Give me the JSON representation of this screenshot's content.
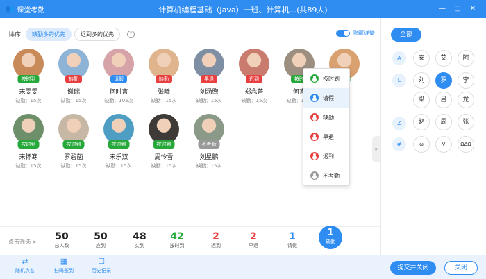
{
  "titlebar": {
    "app_name": "课堂考勤",
    "title": "计算机编程基础（Java）一班、计算机...(共89人)"
  },
  "sort": {
    "label": "排序:",
    "option1": "缺勤多的优先",
    "option2": "迟到多的优先",
    "help": "?"
  },
  "toggle_label": "隐藏详情",
  "status_colors": {
    "按时到": "#26a83a",
    "缺勤": "#e84040",
    "请假": "#2f8cf1",
    "早退": "#e84040",
    "迟到": "#e84040",
    "不考勤": "#999999"
  },
  "students": [
    {
      "name": "宋雯雯",
      "absent": "缺勤：15次",
      "status": "按时到"
    },
    {
      "name": "谢瑞",
      "absent": "缺勤：15次",
      "status": "缺勤"
    },
    {
      "name": "何时言",
      "absent": "缺勤：105次",
      "status": "请假"
    },
    {
      "name": "张曦",
      "absent": "缺勤：15次",
      "status": "缺勤"
    },
    {
      "name": "刘涵煦",
      "absent": "缺勤：15次",
      "status": "早退"
    },
    {
      "name": "郑念普",
      "absent": "缺勤：15次",
      "status": "迟到"
    },
    {
      "name": "何言",
      "absent": "缺勤：15次",
      "status": "按时"
    },
    {
      "name": "昕",
      "absent": "12次",
      "status": "到"
    },
    {
      "name": "宋怀寒",
      "absent": "缺勤：15次",
      "status": "按时到"
    },
    {
      "name": "罗碧菡",
      "absent": "缺勤：15次",
      "status": "按时到"
    },
    {
      "name": "宋乐双",
      "absent": "缺勤：15次",
      "status": "按时到"
    },
    {
      "name": "周怜雪",
      "absent": "缺勤：15次",
      "status": "按时到"
    },
    {
      "name": "刘星鹏",
      "absent": "缺勤：15次",
      "status": "不考勤"
    }
  ],
  "menu": [
    {
      "label": "按时到",
      "color": "#26a83a"
    },
    {
      "label": "请假",
      "color": "#2f8cf1"
    },
    {
      "label": "缺勤",
      "color": "#e84040"
    },
    {
      "label": "早退",
      "color": "#e84040"
    },
    {
      "label": "迟到",
      "color": "#e84040"
    },
    {
      "label": "不考勤",
      "color": "#999999"
    }
  ],
  "right": {
    "all": "全部",
    "letters": [
      "A",
      "L",
      "Z",
      "#"
    ],
    "surnames": [
      "安",
      "艾",
      "阿",
      "刘",
      "罗",
      "李",
      "梁",
      "吕",
      "龙",
      "赵",
      "周",
      "张",
      "·ω·",
      "-V-",
      "ΩΔΩ"
    ]
  },
  "stats": {
    "filter": "点击筛选 >",
    "items": [
      {
        "num": "50",
        "label": "总人数",
        "color": "#222222"
      },
      {
        "num": "50",
        "label": "应到",
        "color": "#222222"
      },
      {
        "num": "48",
        "label": "实到",
        "color": "#222222"
      },
      {
        "num": "42",
        "label": "按时到",
        "color": "#26a83a"
      },
      {
        "num": "2",
        "label": "迟到",
        "color": "#e84040"
      },
      {
        "num": "2",
        "label": "早退",
        "color": "#e84040"
      },
      {
        "num": "1",
        "label": "请假",
        "color": "#2f8cf1"
      }
    ],
    "active": {
      "num": "1",
      "label": "缺勤"
    }
  },
  "bottom": {
    "random": "随机点名",
    "scan": "扫码签到",
    "history": "历史记录",
    "submit": "提交并关闭",
    "close": "关闭"
  }
}
